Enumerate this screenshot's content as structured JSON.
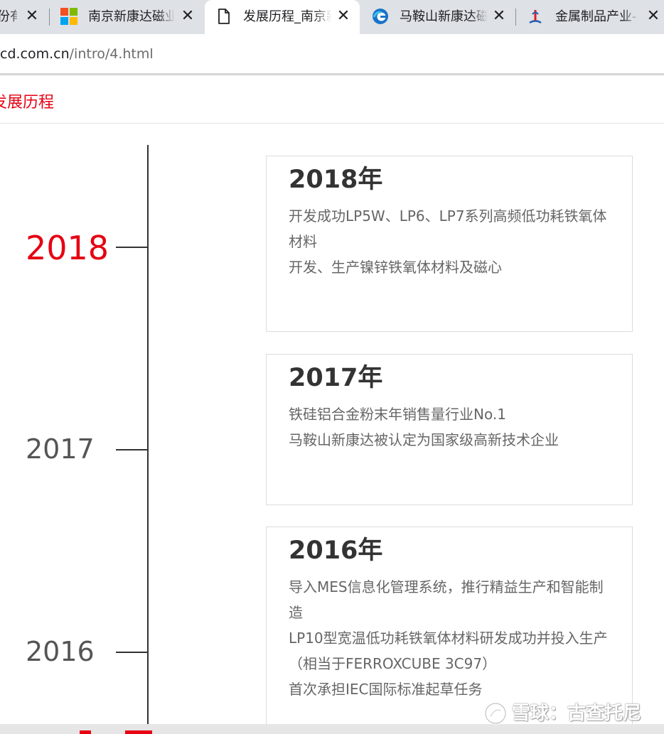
{
  "browser": {
    "tabs": [
      {
        "title": "份有",
        "active": false,
        "icon": "generic-page-icon"
      },
      {
        "title": "南京新康达磁业",
        "active": false,
        "icon": "microsoft-logo-icon"
      },
      {
        "title": "发展历程_南京新",
        "active": true,
        "icon": "document-icon"
      },
      {
        "title": "马鞍山新康达磁",
        "active": false,
        "icon": "edge-browser-icon"
      },
      {
        "title": "金属制品产业-(",
        "active": false,
        "icon": "site-logo-icon"
      }
    ],
    "close_glyph": "✕",
    "url": {
      "host": "cd.com.cn",
      "path": "/intro/4.html"
    }
  },
  "page": {
    "section_title": "发展历程",
    "timeline": [
      {
        "year": "2018",
        "active": true,
        "card_title": "2018年",
        "lines": [
          "开发成功LP5W、LP6、LP7系列高频低功耗铁氧体材料",
          "开发、生产镍锌铁氧体材料及磁心"
        ]
      },
      {
        "year": "2017",
        "active": false,
        "card_title": "2017年",
        "lines": [
          "铁硅铝合金粉末年销售量行业No.1",
          "马鞍山新康达被认定为国家级高新技术企业"
        ]
      },
      {
        "year": "2016",
        "active": false,
        "card_title": "2016年",
        "lines": [
          "导入MES信息化管理系统，推行精益生产和智能制造",
          "LP10型宽温低功耗铁氧体材料研发成功并投入生产（相当于FERROXCUBE 3C97）",
          "首次承担IEC国际标准起草任务"
        ]
      }
    ]
  },
  "watermark": {
    "text": "雪球：古查托尼"
  },
  "colors": {
    "accent": "#e60012",
    "axis": "#333333",
    "card_border": "#dcdcdc",
    "tabstrip": "#dee1e6"
  }
}
